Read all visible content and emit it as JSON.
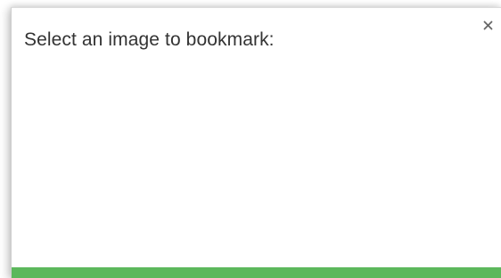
{
  "dialog": {
    "title": "Select an image to bookmark:",
    "close_icon": "close-icon",
    "accent_color": "#5cb85c",
    "title_color": "#333333"
  }
}
